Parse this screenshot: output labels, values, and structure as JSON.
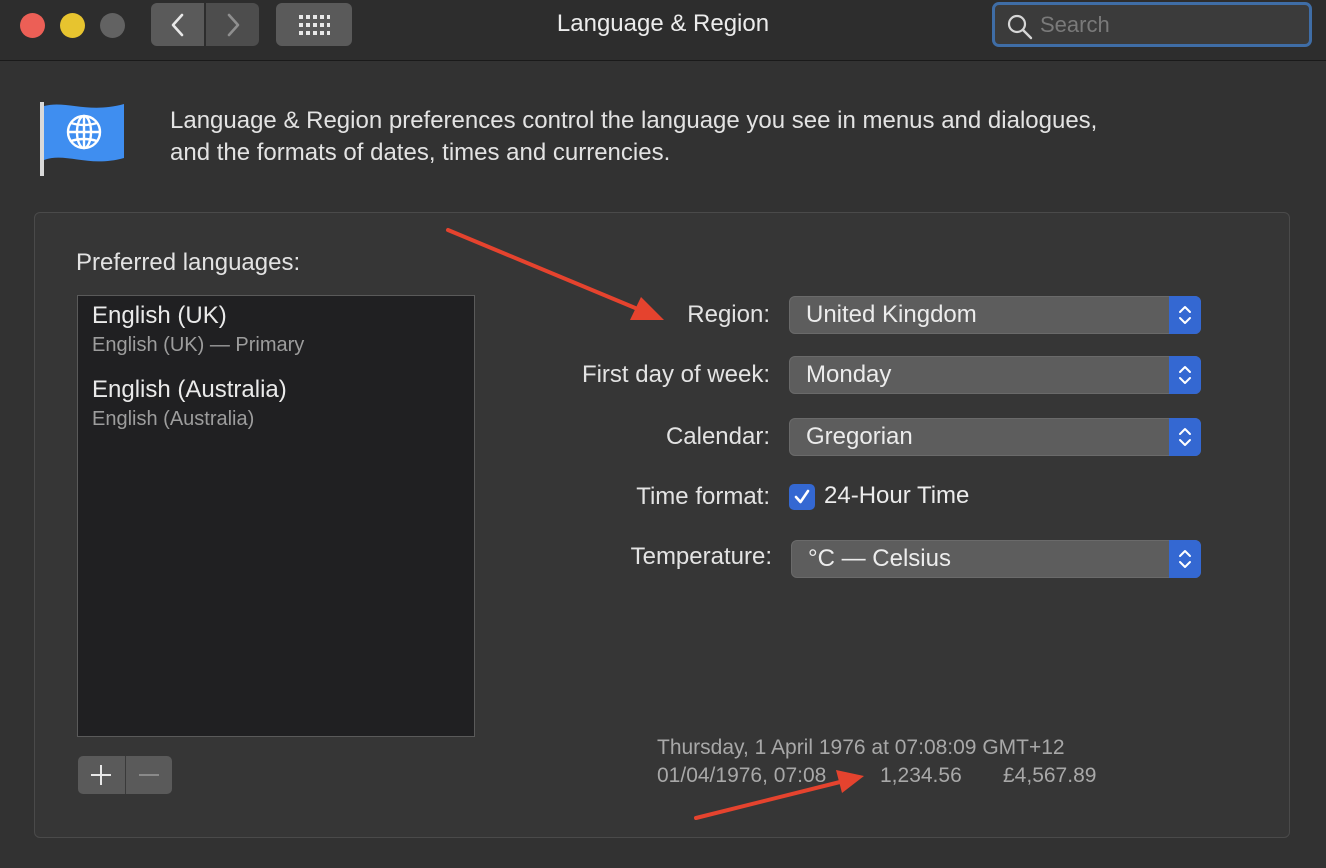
{
  "window": {
    "title": "Language & Region",
    "traffic_lights": [
      "close",
      "minimize",
      "zoom"
    ]
  },
  "search": {
    "placeholder": "Search",
    "value": ""
  },
  "intro": {
    "line1": "Language & Region preferences control the language you see in menus and dialogues,",
    "line2": "and the formats of dates, times and currencies."
  },
  "languages": {
    "label": "Preferred languages:",
    "items": [
      {
        "name": "English (UK)",
        "sub": "English (UK) — Primary"
      },
      {
        "name": "English (Australia)",
        "sub": "English (Australia)"
      }
    ],
    "add_icon": "plus-icon",
    "remove_icon": "minus-icon"
  },
  "settings": {
    "region": {
      "label": "Region:",
      "value": "United Kingdom"
    },
    "first_day": {
      "label": "First day of week:",
      "value": "Monday"
    },
    "calendar": {
      "label": "Calendar:",
      "value": "Gregorian"
    },
    "time_format": {
      "label": "Time format:",
      "checkbox_label": "24-Hour Time",
      "checked": true
    },
    "temperature": {
      "label": "Temperature:",
      "value": "°C — Celsius"
    }
  },
  "sample": {
    "line1": "Thursday, 1 April 1976 at 07:08:09 GMT+12",
    "date_short": "01/04/1976, 07:08",
    "number": "1,234.56",
    "currency": "£4,567.89"
  },
  "colors": {
    "accent": "#3468d2",
    "annotation_arrow": "#e5432e",
    "close": "#ec5f56",
    "minimize": "#e7c42f"
  }
}
